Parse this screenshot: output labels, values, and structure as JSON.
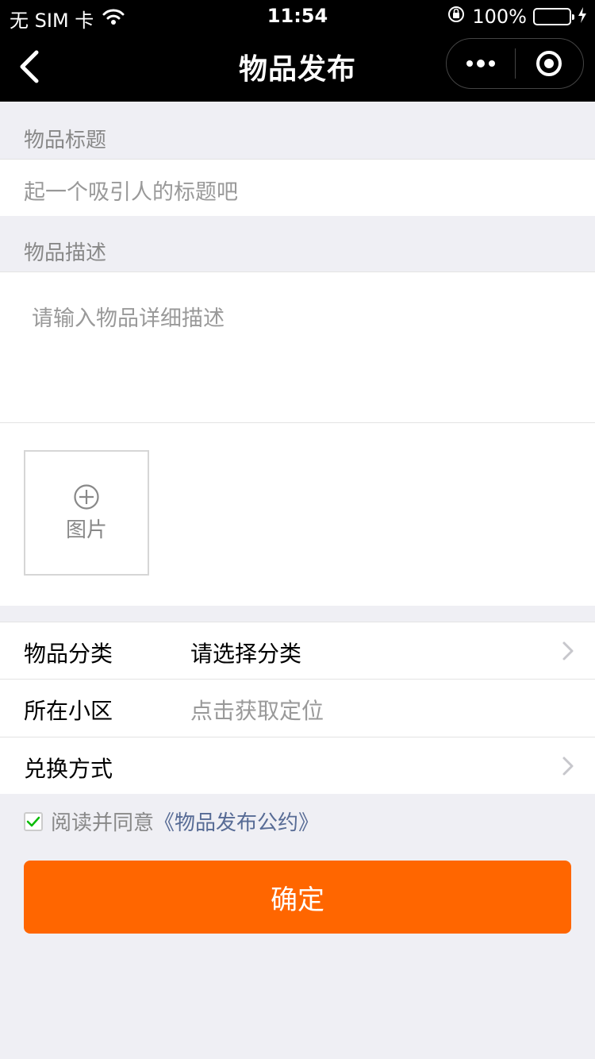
{
  "status_bar": {
    "carrier": "无 SIM 卡",
    "time": "11:54",
    "battery": "100%",
    "battery_level": 1.0
  },
  "nav": {
    "title": "物品发布",
    "back_icon": "chevron-left-icon",
    "more_icon": "more-dots-icon",
    "close_icon": "target-circle-icon"
  },
  "title_section": {
    "label": "物品标题",
    "placeholder": "起一个吸引人的标题吧"
  },
  "desc_section": {
    "label": "物品描述",
    "placeholder": "请输入物品详细描述"
  },
  "upload": {
    "label": "图片",
    "icon": "plus-circle-icon"
  },
  "rows": [
    {
      "label": "物品分类",
      "value": "请选择分类",
      "has_arrow": true
    },
    {
      "label": "所在小区",
      "value": "点击获取定位",
      "has_arrow": false
    },
    {
      "label": "兑换方式",
      "value": "",
      "has_arrow": true
    }
  ],
  "agreement": {
    "text": "阅读并同意",
    "link": "《物品发布公约》",
    "checked": true
  },
  "confirm_button": "确定",
  "colors": {
    "accent": "#ff6600",
    "link": "#576b95",
    "check": "#09bb07",
    "background": "#efeff4"
  }
}
